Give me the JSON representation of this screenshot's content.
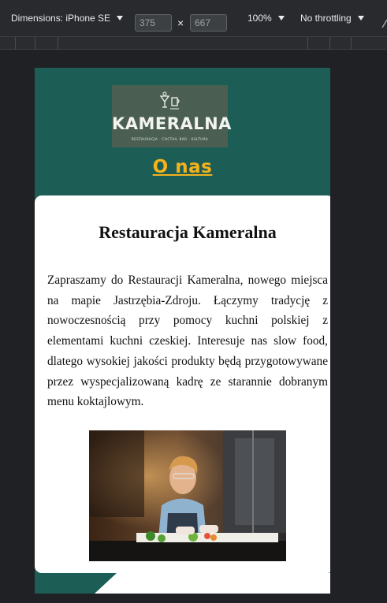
{
  "devtools": {
    "dimensions_label": "Dimensions: iPhone SE",
    "width": "375",
    "height": "667",
    "times": "×",
    "zoom": "100%",
    "throttling": "No throttling"
  },
  "page": {
    "logo": {
      "name": "KAMERALNA",
      "tagline": "RESTAURACJA · COCTAIL BAR · KULTURA"
    },
    "nav_link": "O nas",
    "heading": "Restauracja Kameralna",
    "paragraph": "Zapraszamy do Restauracji Kameralna, nowego miejsca na mapie Jastrzębia-Zdroju. Łączymy tradycję z nowoczesnością przy pomocy kuchni polskiej z elementami kuchni czeskiej. Interesuje nas slow food, dlatego wysokiej jakości produkty będą przygotowywane przez wyspecjalizowaną kadrę ze starannie dobranym menu koktajlowym."
  },
  "colors": {
    "viewport_bg": "#1c5e55",
    "link": "#f6b21c",
    "logo_bg": "#4a5e52"
  }
}
